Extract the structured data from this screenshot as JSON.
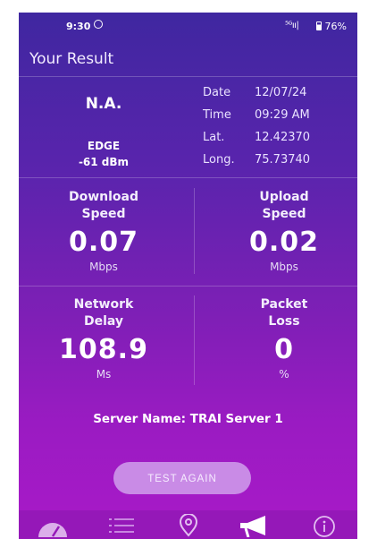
{
  "status_bar": {
    "time": "9:30",
    "signal": "⁵ᴳıı|",
    "battery": "76%"
  },
  "header": {
    "title": "Your Result"
  },
  "network": {
    "operator": "N.A.",
    "type": "EDGE",
    "strength": "-61 dBm"
  },
  "details": [
    {
      "label": "Date",
      "value": "12/07/24"
    },
    {
      "label": "Time",
      "value": "09:29 AM"
    },
    {
      "label": "Lat.",
      "value": "12.42370"
    },
    {
      "label": "Long.",
      "value": "75.73740"
    }
  ],
  "metrics": {
    "download": {
      "label1": "Download",
      "label2": "Speed",
      "value": "0.07",
      "unit": "Mbps"
    },
    "upload": {
      "label1": "Upload",
      "label2": "Speed",
      "value": "0.02",
      "unit": "Mbps"
    },
    "delay": {
      "label1": "Network",
      "label2": "Delay",
      "value": "108.9",
      "unit": "Ms"
    },
    "loss": {
      "label1": "Packet",
      "label2": "Loss",
      "value": "0",
      "unit": "%"
    }
  },
  "server": {
    "text": "Server Name: TRAI Server 1"
  },
  "actions": {
    "test_again": "TEST AGAIN"
  },
  "nav": {
    "icons": [
      "speedometer-icon",
      "list-icon",
      "location-pin-icon",
      "megaphone-icon",
      "info-icon"
    ]
  },
  "colors": {
    "gradient_top": "#3f27a0",
    "gradient_bottom": "#a91ac8",
    "button": "#c98be6",
    "nav_bar": "#9518b8"
  }
}
